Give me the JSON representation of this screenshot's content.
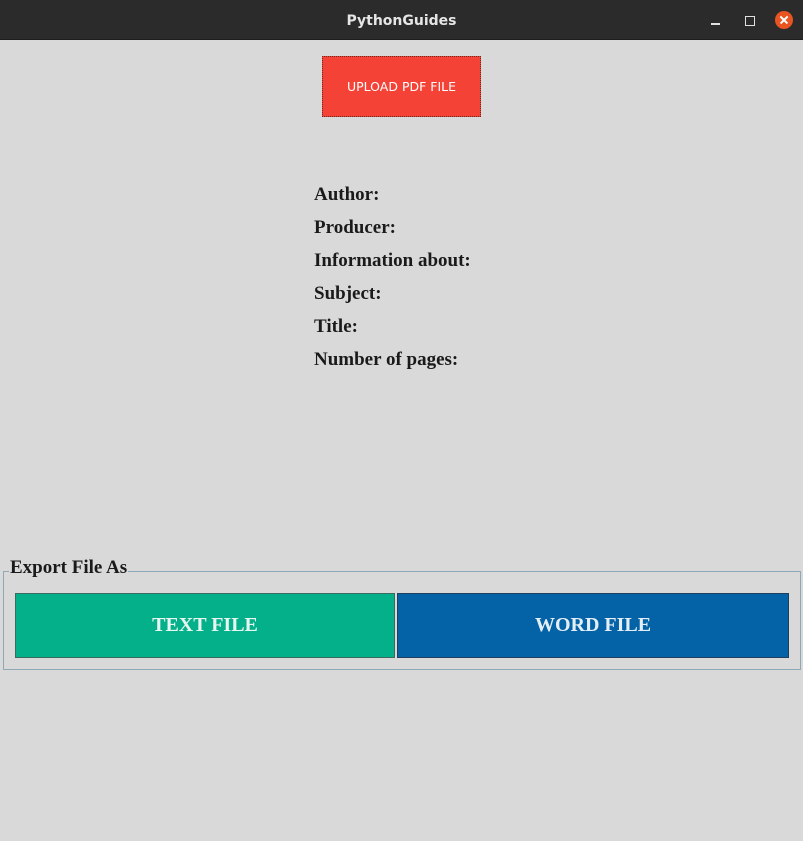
{
  "window": {
    "title": "PythonGuides"
  },
  "upload": {
    "label": "UPLOAD PDF FILE"
  },
  "info": {
    "items": [
      {
        "label": "Author:"
      },
      {
        "label": "Producer:"
      },
      {
        "label": "Information about:"
      },
      {
        "label": "Subject:"
      },
      {
        "label": "Title:"
      },
      {
        "label": "Number of pages:"
      }
    ]
  },
  "export": {
    "legend": "Export File As",
    "text_label": "TEXT FILE",
    "word_label": "WORD FILE"
  },
  "colors": {
    "titlebar": "#2b2b2b",
    "background": "#d9d9d9",
    "upload": "#f44336",
    "text_button": "#04b08a",
    "word_button": "#0462a6",
    "close": "#e95420"
  },
  "icons": {
    "minimize": "minimize-icon",
    "maximize": "maximize-icon",
    "close": "close-icon"
  }
}
